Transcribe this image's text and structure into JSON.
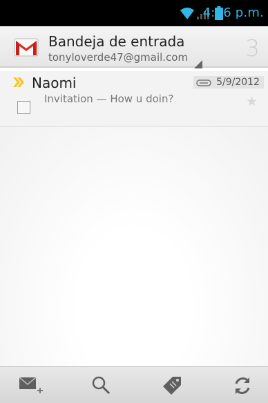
{
  "status_bar": {
    "time": "4:46 p.m.",
    "icons": [
      "wifi-icon",
      "signal-icon",
      "battery-icon"
    ],
    "accent_color": "#33b5e5"
  },
  "header": {
    "title": "Bandeja de entrada",
    "account": "tonyloverde47@gmail.com",
    "unread_count": "3",
    "logo": "gmail-icon"
  },
  "messages": [
    {
      "sender": "Naomi",
      "subject": "Invitation — How u doin?",
      "date": "5/9/2012",
      "has_attachment": true,
      "important": true,
      "starred": false,
      "checked": false
    }
  ],
  "bottom_bar": {
    "actions": [
      "compose-icon",
      "search-icon",
      "labels-icon",
      "refresh-icon"
    ]
  }
}
